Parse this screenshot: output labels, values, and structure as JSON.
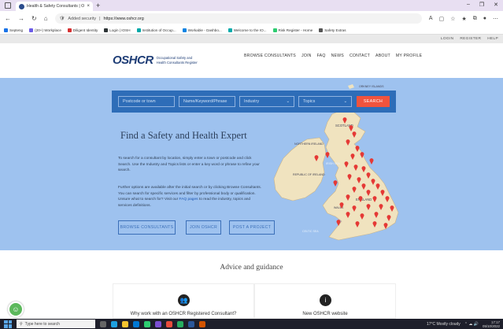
{
  "browser": {
    "tab_title": "Health & Safety Consultants | O",
    "tab_close": "×",
    "new_tab": "+",
    "security": "Added security",
    "url": "https://www.oshcr.org",
    "bookmarks": [
      "Septeng",
      "(20+) Workplace",
      "Diligent Identity",
      "Login | IOSH",
      "Institution of Occup...",
      "Workable - Dashbo...",
      "Welcome to the IO...",
      "Risk Register - Home",
      "Safety Extras"
    ],
    "bookmark_colors": [
      "#1a73e8",
      "#6c5ce7",
      "#d63031",
      "#2d3436",
      "#00a8a8",
      "#0984e3",
      "#0aa",
      "#2ecc71",
      "#555"
    ]
  },
  "site": {
    "top_links": [
      "LOGIN",
      "REGISTER",
      "HELP"
    ],
    "logo_mark": "OSHCR",
    "logo_tag_1": "Occupational Safety and",
    "logo_tag_2": "Health Consultants Register",
    "nav": [
      "BROWSE CONSULTANTS",
      "JOIN",
      "FAQ",
      "NEWS",
      "CONTACT",
      "ABOUT",
      "MY PROFILE"
    ]
  },
  "search": {
    "postcode_placeholder": "Postcode or town",
    "keyword_placeholder": "Name/Keyword/Phrase",
    "industry": "Industry",
    "topics": "Topics",
    "button": "SEARCH"
  },
  "hero": {
    "title": "Find a Safety and Health Expert",
    "para1": "To search for a consultant by location, simply enter a town or postcode and click Search. Use the Industry and Topics lists or enter a key word or phrase to refine your search.",
    "para2_a": "Further options are available after the initial search or by clicking Browse Consultants. You can search for specific services and filter by professional body or qualification. Unsure what to search for? Visit our",
    "para2_link": "FAQ pages",
    "para2_b": "to read the industry, topics and services definitions.",
    "buttons": [
      "BROWSE CONSULTANTS",
      "JOIN OSHCR",
      "POST A PROJECT"
    ]
  },
  "map_labels": {
    "orkney": "ORKNEY ISLANDS",
    "scotland": "SCOTLAND",
    "northern_ireland": "NORTHERN IRELAND",
    "irish_sea": "IRISH SEA",
    "republic": "REPUBLIC OF IRELAND",
    "wales": "WALES",
    "england": "ENGLAND",
    "celtic_sea": "CELTIC SEA"
  },
  "advice": {
    "title": "Advice and guidance",
    "card1_label": "Why work with an OSHCR Registered Consultant?",
    "card2_label": "New OSHCR website"
  },
  "taskbar": {
    "search_placeholder": "Type here to search",
    "weather": "17°C  Mostly cloudy",
    "time": "17:17",
    "date": "05/10/2022"
  },
  "colors": {
    "hero_bg": "#9ec2ef",
    "search_bar": "#2e6db8",
    "search_button": "#f0533d",
    "brand": "#1e3d76",
    "pin": "#e53935"
  }
}
